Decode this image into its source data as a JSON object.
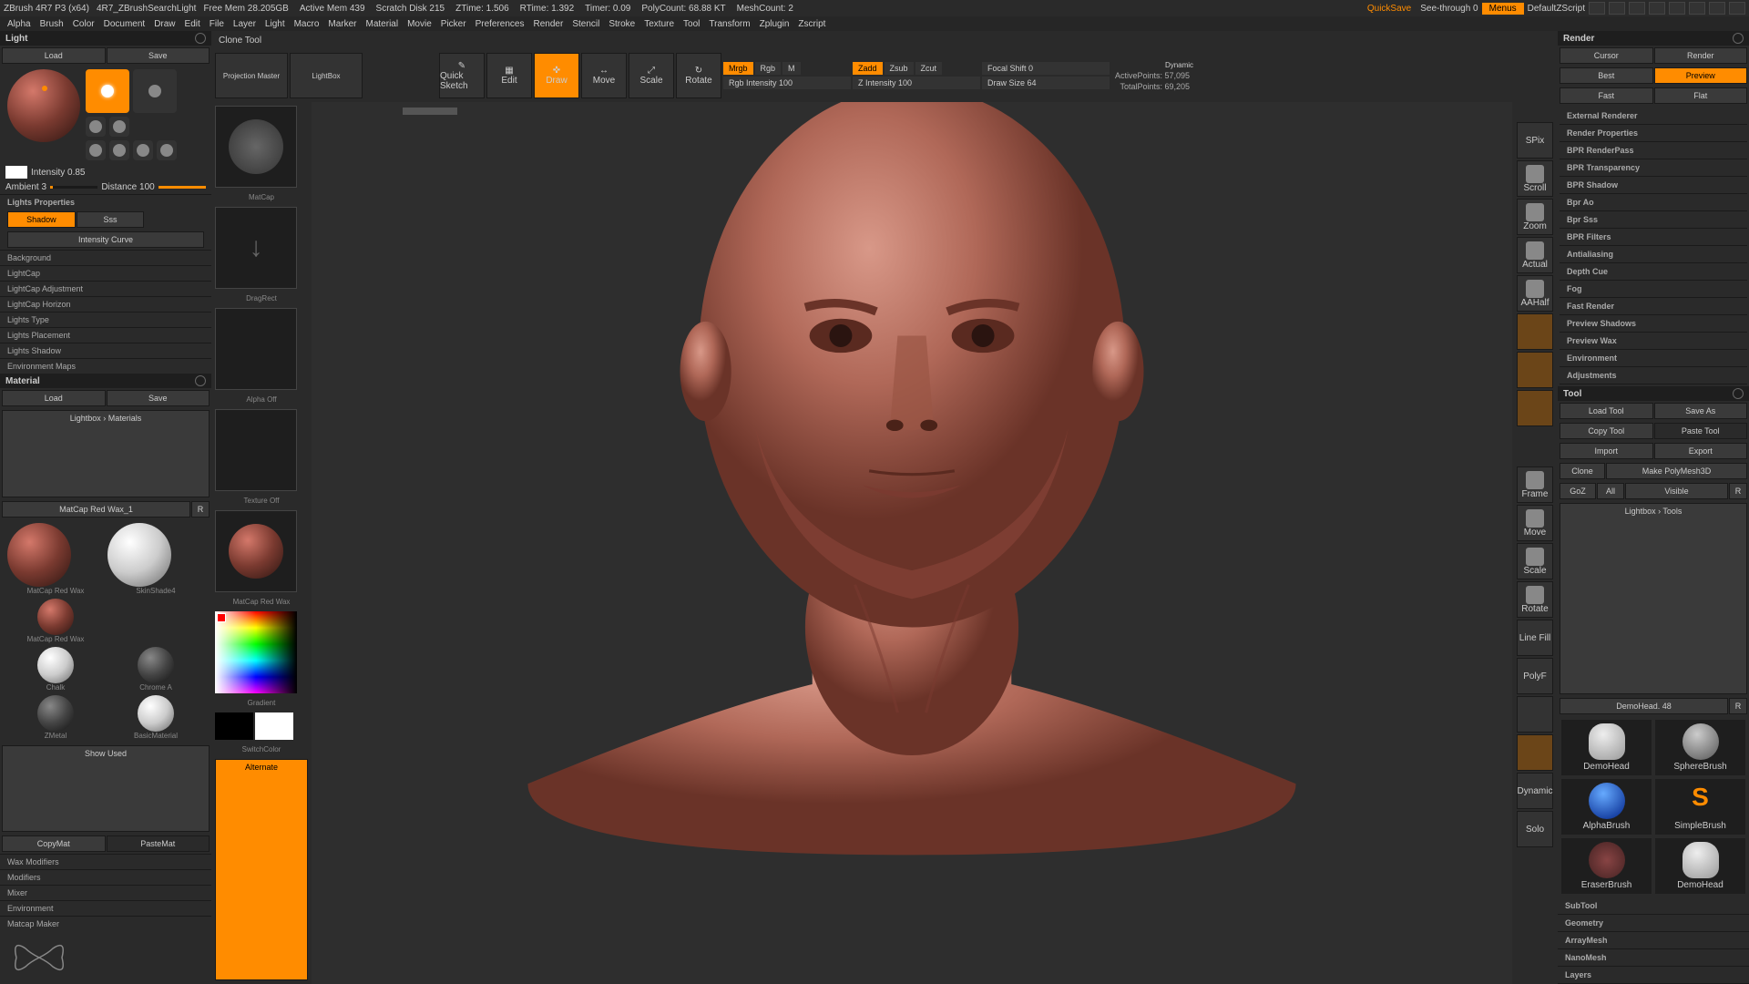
{
  "titlebar": {
    "app": "ZBrush 4R7 P3 (x64)",
    "doc": "4R7_ZBrushSearchLight",
    "stats": [
      "Free Mem 28.205GB",
      "Active Mem 439",
      "Scratch Disk 215",
      "ZTime: 1.506",
      "RTime: 1.392",
      "Timer: 0.09",
      "PolyCount: 68.88 KT",
      "MeshCount: 2"
    ],
    "quicksave": "QuickSave",
    "seethrough": "See-through  0",
    "menus": "Menus",
    "script": "DefaultZScript"
  },
  "menubar": [
    "Alpha",
    "Brush",
    "Color",
    "Document",
    "Draw",
    "Edit",
    "File",
    "Layer",
    "Light",
    "Macro",
    "Marker",
    "Material",
    "Movie",
    "Picker",
    "Preferences",
    "Render",
    "Stencil",
    "Stroke",
    "Texture",
    "Tool",
    "Transform",
    "Zplugin",
    "Zscript"
  ],
  "light": {
    "title": "Light",
    "load": "Load",
    "save": "Save",
    "intensity_label": "Intensity 0.85",
    "ambient": "Ambient 3",
    "distance": "Distance 100",
    "props": "Lights Properties",
    "shadow": "Shadow",
    "sss": "Sss",
    "curve": "Intensity Curve",
    "sections": [
      "Background",
      "LightCap",
      "LightCap Adjustment",
      "LightCap Horizon",
      "Lights Type",
      "Lights Placement",
      "Lights Shadow",
      "Environment Maps"
    ]
  },
  "material": {
    "title": "Material",
    "load": "Load",
    "save": "Save",
    "lightbox": "Lightbox › Materials",
    "current": "MatCap Red Wax_1",
    "r": "R",
    "mats": [
      {
        "name": "MatCap Red Wax"
      },
      {
        "name": "SkinShade4"
      },
      {
        "name": ""
      },
      {
        "name": "MatCap Red Wax"
      },
      {
        "name": "Chalk"
      },
      {
        "name": "Chrome A"
      },
      {
        "name": "ZMetal"
      },
      {
        "name": "BasicMaterial"
      }
    ],
    "show_used": "Show Used",
    "copymat": "CopyMat",
    "pastemat": "PasteMat",
    "sections": [
      "Wax Modifiers",
      "Modifiers",
      "Mixer",
      "Environment",
      "Matcap Maker"
    ]
  },
  "center": {
    "tool_name": "Clone Tool",
    "proj_master": "Projection Master",
    "lightbox": "LightBox",
    "quick_sketch": "Quick Sketch",
    "modes": [
      "Edit",
      "Draw",
      "Move",
      "Scale",
      "Rotate"
    ],
    "mrgb": "Mrgb",
    "rgb": "Rgb",
    "m": "M",
    "rgb_intensity": "Rgb Intensity 100",
    "zadd": "Zadd",
    "zsub": "Zsub",
    "zcut": "Zcut",
    "z_intensity": "Z Intensity 100",
    "focal_shift": "Focal Shift 0",
    "draw_size": "Draw Size 64",
    "dynamic": "Dynamic",
    "active_points": "ActivePoints: 57,095",
    "total_points": "TotalPoints: 69,205"
  },
  "canvas_left": {
    "thumbs": [
      {
        "label": "MatCap"
      },
      {
        "label": "DragRect"
      },
      {
        "label": ""
      },
      {
        "label": "Alpha Off"
      },
      {
        "label": "Texture Off"
      },
      {
        "label": "MatCap Red Wax"
      }
    ],
    "gradient": "Gradient",
    "switchcolor": "SwitchColor",
    "alternate": "Alternate"
  },
  "right_strip": [
    "SPix",
    "Scroll",
    "Zoom",
    "Actual",
    "AAHalf",
    "",
    "",
    "",
    "",
    "",
    "Frame",
    "Move",
    "Scale",
    "Rotate",
    "Line Fill",
    "PolyF",
    "",
    "",
    "Dynamic",
    "Solo"
  ],
  "render": {
    "title": "Render",
    "cursor": "Cursor",
    "render_btn": "Render",
    "best": "Best",
    "preview": "Preview",
    "fast": "Fast",
    "flat": "Flat",
    "sections": [
      "External Renderer",
      "Render Properties",
      "BPR RenderPass",
      "BPR Transparency",
      "BPR Shadow",
      "Bpr Ao",
      "Bpr Sss",
      "BPR Filters",
      "Antialiasing",
      "Depth Cue",
      "Fog",
      "Fast Render",
      "Preview Shadows",
      "Preview Wax",
      "Environment",
      "Adjustments"
    ]
  },
  "tool": {
    "title": "Tool",
    "load_tool": "Load Tool",
    "save_as": "Save As",
    "copy_tool": "Copy Tool",
    "paste_tool": "Paste Tool",
    "import": "Import",
    "export": "Export",
    "clone": "Clone",
    "make_poly": "Make PolyMesh3D",
    "goz": "GoZ",
    "all": "All",
    "visible": "Visible",
    "r": "R",
    "lightbox_tools": "Lightbox › Tools",
    "demohead": "DemoHead. 48",
    "r2": "R",
    "tools": [
      {
        "name": "DemoHead"
      },
      {
        "name": "SphereBrush"
      },
      {
        "name": ""
      },
      {
        "name": "AlphaBrush"
      },
      {
        "name": "SimpleBrush"
      },
      {
        "name": "EraserBrush"
      },
      {
        "name": "DemoHead"
      },
      {
        "name": ""
      }
    ],
    "sections": [
      "SubTool",
      "Geometry",
      "ArrayMesh",
      "NanoMesh",
      "Layers"
    ]
  }
}
